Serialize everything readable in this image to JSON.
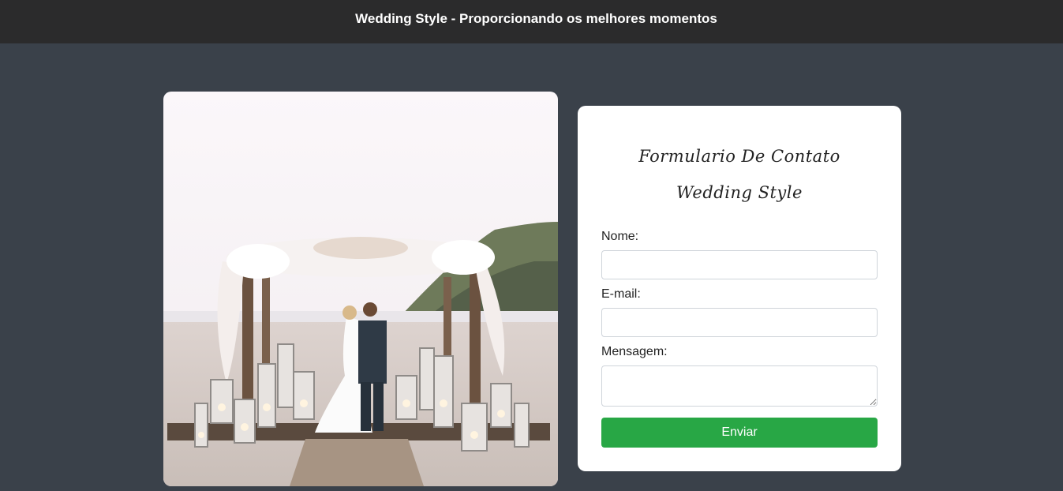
{
  "header": {
    "title": "Wedding Style - Proporcionando os melhores momentos"
  },
  "photo": {
    "alt": "Casal se beijando sob arco de flores na praia"
  },
  "form": {
    "title_line1": "Formulario De Contato",
    "title_line2": "Wedding Style",
    "name_label": "Nome:",
    "name_value": "",
    "email_label": "E-mail:",
    "email_value": "",
    "message_label": "Mensagem:",
    "message_value": "",
    "submit_label": "Enviar"
  },
  "colors": {
    "background": "#3a414a",
    "header": "#2b2b2c",
    "submit": "#28a745"
  }
}
